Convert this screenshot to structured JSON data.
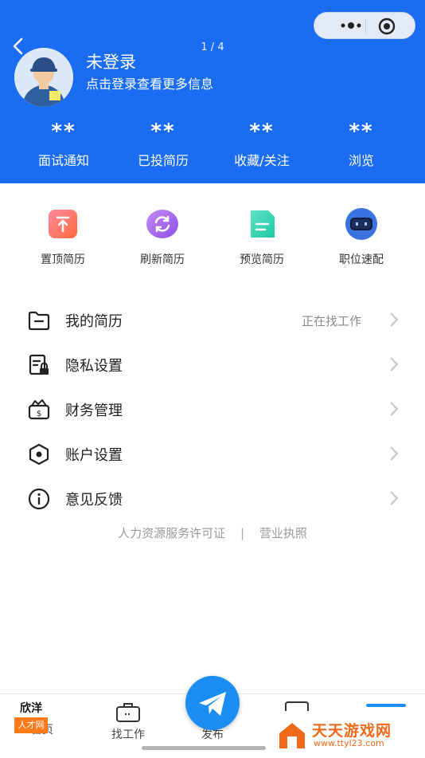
{
  "header": {
    "page_indicator": "1 / 4",
    "user_name": "未登录",
    "user_subtitle": "点击登录查看更多信息",
    "accent_color": "#1a6cf2"
  },
  "stats": [
    {
      "value": "**",
      "label": "面试通知"
    },
    {
      "value": "**",
      "label": "已投简历"
    },
    {
      "value": "**",
      "label": "收藏/关注"
    },
    {
      "value": "**",
      "label": "浏览"
    }
  ],
  "quick_actions": [
    {
      "label": "置顶简历",
      "icon": "pin-top-icon"
    },
    {
      "label": "刷新简历",
      "icon": "refresh-icon"
    },
    {
      "label": "预览简历",
      "icon": "document-icon"
    },
    {
      "label": "职位速配",
      "icon": "robot-icon"
    }
  ],
  "menu": [
    {
      "label": "我的简历",
      "hint": "正在找工作",
      "icon": "folder-icon"
    },
    {
      "label": "隐私设置",
      "hint": "",
      "icon": "privacy-lock-icon"
    },
    {
      "label": "财务管理",
      "hint": "",
      "icon": "wallet-icon"
    },
    {
      "label": "账户设置",
      "hint": "",
      "icon": "settings-hexagon-icon"
    },
    {
      "label": "意见反馈",
      "hint": "",
      "icon": "info-icon"
    }
  ],
  "footer_links": {
    "license": "人力资源服务许可证",
    "separator": "|",
    "business": "营业执照"
  },
  "tabbar": {
    "home": "首页",
    "jobs": "找工作",
    "publish": "发布"
  },
  "watermarks": {
    "left_top": "欣洋",
    "left_bottom": "人才网",
    "right_title": "天天游戏网",
    "right_url": "www.ttyl23.com"
  }
}
